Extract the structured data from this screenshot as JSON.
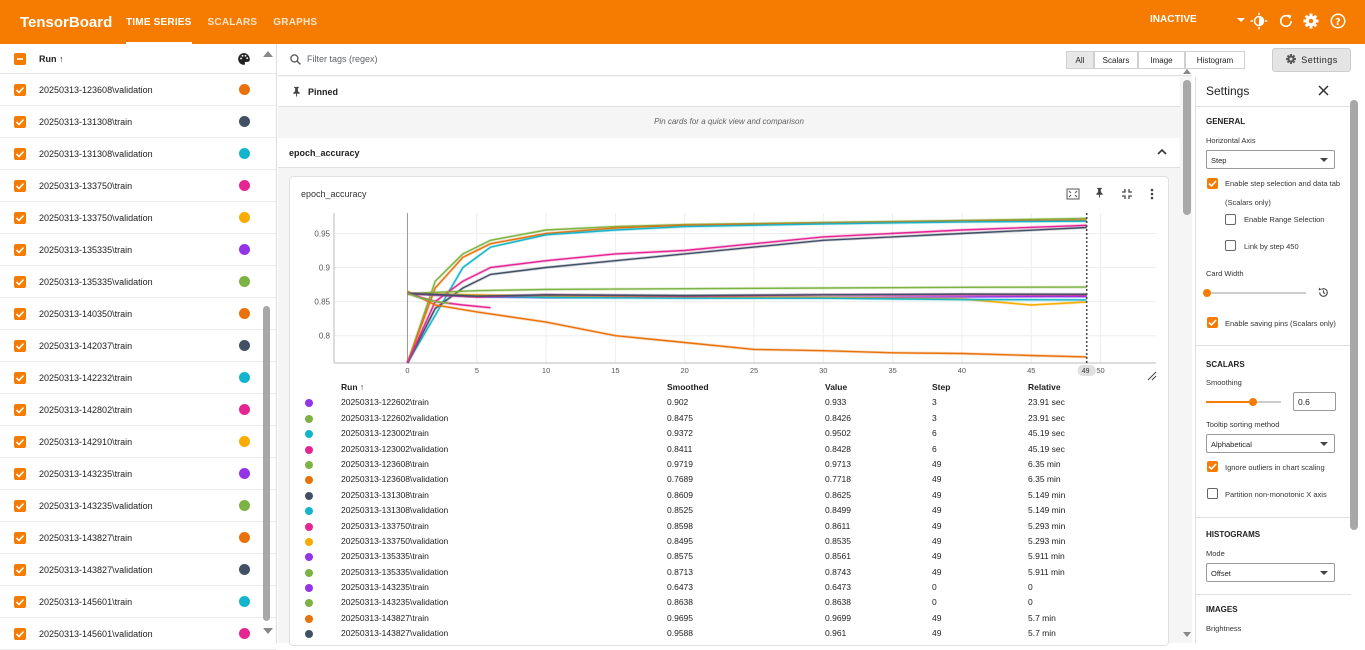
{
  "app": {
    "brand": "TensorBoard",
    "tabs": [
      "TIME SERIES",
      "SCALARS",
      "GRAPHS"
    ],
    "status": "INACTIVE"
  },
  "colors": {
    "accent": "#f57c00"
  },
  "runs_panel": {
    "header": "Run ↑",
    "rows": [
      {
        "name": "20250313-123608\\validation",
        "color": "#e8710a"
      },
      {
        "name": "20250313-131308\\train",
        "color": "#425066"
      },
      {
        "name": "20250313-131308\\validation",
        "color": "#12b5cb"
      },
      {
        "name": "20250313-133750\\train",
        "color": "#e52592"
      },
      {
        "name": "20250313-133750\\validation",
        "color": "#f9ab00"
      },
      {
        "name": "20250313-135335\\train",
        "color": "#9334e6"
      },
      {
        "name": "20250313-135335\\validation",
        "color": "#7cb342"
      },
      {
        "name": "20250313-140350\\train",
        "color": "#e8710a"
      },
      {
        "name": "20250313-142037\\train",
        "color": "#425066"
      },
      {
        "name": "20250313-142232\\train",
        "color": "#12b5cb"
      },
      {
        "name": "20250313-142802\\train",
        "color": "#e52592"
      },
      {
        "name": "20250313-142910\\train",
        "color": "#f9ab00"
      },
      {
        "name": "20250313-143235\\train",
        "color": "#9334e6"
      },
      {
        "name": "20250313-143235\\validation",
        "color": "#7cb342"
      },
      {
        "name": "20250313-143827\\train",
        "color": "#e8710a"
      },
      {
        "name": "20250313-143827\\validation",
        "color": "#425066"
      },
      {
        "name": "20250313-145601\\train",
        "color": "#12b5cb"
      },
      {
        "name": "20250313-145601\\validation",
        "color": "#e52592"
      }
    ]
  },
  "filter": {
    "placeholder": "Filter tags (regex)",
    "types": [
      "All",
      "Scalars",
      "Image",
      "Histogram"
    ],
    "settings_label": "Settings"
  },
  "pinned": {
    "title": "Pinned",
    "hint": "Pin cards for a quick view and comparison"
  },
  "group": {
    "title": "epoch_accuracy"
  },
  "card": {
    "title": "epoch_accuracy",
    "step_badge": "49",
    "table": {
      "headers": [
        "Run ↑",
        "Smoothed",
        "Value",
        "Step",
        "Relative"
      ],
      "rows": [
        {
          "run": "20250313-122602\\train",
          "smoothed": "0.902",
          "value": "0.933",
          "step": "3",
          "relative": "23.91 sec",
          "color": "#9334e6"
        },
        {
          "run": "20250313-122602\\validation",
          "smoothed": "0.8475",
          "value": "0.8426",
          "step": "3",
          "relative": "23.91 sec",
          "color": "#7cb342"
        },
        {
          "run": "20250313-123002\\train",
          "smoothed": "0.9372",
          "value": "0.9502",
          "step": "6",
          "relative": "45.19 sec",
          "color": "#12b5cb"
        },
        {
          "run": "20250313-123002\\validation",
          "smoothed": "0.8411",
          "value": "0.8428",
          "step": "6",
          "relative": "45.19 sec",
          "color": "#e52592"
        },
        {
          "run": "20250313-123608\\train",
          "smoothed": "0.9719",
          "value": "0.9713",
          "step": "49",
          "relative": "6.35 min",
          "color": "#7cb342"
        },
        {
          "run": "20250313-123608\\validation",
          "smoothed": "0.7689",
          "value": "0.7718",
          "step": "49",
          "relative": "6.35 min",
          "color": "#e8710a"
        },
        {
          "run": "20250313-131308\\train",
          "smoothed": "0.8609",
          "value": "0.8625",
          "step": "49",
          "relative": "5.149 min",
          "color": "#425066"
        },
        {
          "run": "20250313-131308\\validation",
          "smoothed": "0.8525",
          "value": "0.8499",
          "step": "49",
          "relative": "5.149 min",
          "color": "#12b5cb"
        },
        {
          "run": "20250313-133750\\train",
          "smoothed": "0.8598",
          "value": "0.8611",
          "step": "49",
          "relative": "5.293 min",
          "color": "#e52592"
        },
        {
          "run": "20250313-133750\\validation",
          "smoothed": "0.8495",
          "value": "0.8535",
          "step": "49",
          "relative": "5.293 min",
          "color": "#f9ab00"
        },
        {
          "run": "20250313-135335\\train",
          "smoothed": "0.8575",
          "value": "0.8561",
          "step": "49",
          "relative": "5.911 min",
          "color": "#9334e6"
        },
        {
          "run": "20250313-135335\\validation",
          "smoothed": "0.8713",
          "value": "0.8743",
          "step": "49",
          "relative": "5.911 min",
          "color": "#7cb342"
        },
        {
          "run": "20250313-143235\\train",
          "smoothed": "0.6473",
          "value": "0.6473",
          "step": "0",
          "relative": "0",
          "color": "#9334e6"
        },
        {
          "run": "20250313-143235\\validation",
          "smoothed": "0.8638",
          "value": "0.8638",
          "step": "0",
          "relative": "0",
          "color": "#7cb342"
        },
        {
          "run": "20250313-143827\\train",
          "smoothed": "0.9695",
          "value": "0.9699",
          "step": "49",
          "relative": "5.7 min",
          "color": "#e8710a"
        },
        {
          "run": "20250313-143827\\validation",
          "smoothed": "0.9588",
          "value": "0.961",
          "step": "49",
          "relative": "5.7 min",
          "color": "#425066"
        }
      ]
    }
  },
  "chart_data": {
    "type": "line",
    "title": "epoch_accuracy",
    "xlim": [
      0,
      50
    ],
    "ylim": [
      0.76,
      0.98
    ],
    "xticks": [
      0,
      5,
      10,
      15,
      20,
      25,
      30,
      35,
      40,
      45,
      50
    ],
    "yticks": [
      0.8,
      0.85,
      0.9,
      0.95
    ],
    "xtick_labels": [
      "0",
      "5",
      "10",
      "15",
      "20",
      "25",
      "30",
      "35",
      "40",
      "45",
      "50"
    ],
    "ytick_labels": [
      "0.8",
      "0.85",
      "0.9",
      "0.95"
    ],
    "series": [
      {
        "color": "#7cb342",
        "x": [
          0,
          2,
          4,
          6,
          10,
          15,
          20,
          30,
          40,
          49
        ],
        "y": [
          0.76,
          0.88,
          0.92,
          0.94,
          0.955,
          0.96,
          0.963,
          0.966,
          0.969,
          0.9719
        ]
      },
      {
        "color": "#e8710a",
        "x": [
          0,
          2,
          4,
          6,
          10,
          15,
          20,
          30,
          40,
          49
        ],
        "y": [
          0.76,
          0.87,
          0.915,
          0.935,
          0.95,
          0.958,
          0.962,
          0.965,
          0.968,
          0.9695
        ]
      },
      {
        "color": "#12b5cb",
        "x": [
          0,
          2,
          4,
          6,
          10,
          15,
          20,
          30,
          40,
          49
        ],
        "y": [
          0.76,
          0.83,
          0.9,
          0.93,
          0.948,
          0.955,
          0.96,
          0.964,
          0.967,
          0.968
        ]
      },
      {
        "color": "#425066",
        "x": [
          0,
          2,
          4,
          6,
          10,
          15,
          20,
          25,
          30,
          40,
          49
        ],
        "y": [
          0.76,
          0.84,
          0.87,
          0.89,
          0.9,
          0.91,
          0.92,
          0.93,
          0.94,
          0.95,
          0.9588
        ]
      },
      {
        "color": "#e52592",
        "x": [
          0,
          2,
          4,
          6,
          10,
          15,
          20,
          25,
          30,
          40,
          49
        ],
        "y": [
          0.76,
          0.85,
          0.88,
          0.9,
          0.91,
          0.92,
          0.925,
          0.935,
          0.945,
          0.955,
          0.962
        ]
      },
      {
        "color": "#e8710a",
        "x": [
          0,
          2,
          5,
          10,
          15,
          20,
          25,
          30,
          35,
          40,
          45,
          49
        ],
        "y": [
          0.865,
          0.845,
          0.835,
          0.82,
          0.8,
          0.79,
          0.78,
          0.778,
          0.775,
          0.774,
          0.771,
          0.7689
        ]
      },
      {
        "color": "#7cb342",
        "x": [
          0,
          5,
          10,
          20,
          30,
          40,
          49
        ],
        "y": [
          0.862,
          0.866,
          0.868,
          0.869,
          0.87,
          0.871,
          0.8713
        ]
      },
      {
        "color": "#9334e6",
        "x": [
          0,
          5,
          10,
          20,
          30,
          40,
          49
        ],
        "y": [
          0.862,
          0.857,
          0.856,
          0.857,
          0.856,
          0.857,
          0.8575
        ]
      },
      {
        "color": "#f9ab00",
        "x": [
          0,
          5,
          10,
          20,
          30,
          40,
          45,
          49
        ],
        "y": [
          0.862,
          0.86,
          0.858,
          0.857,
          0.856,
          0.854,
          0.845,
          0.8495
        ]
      },
      {
        "color": "#12b5cb",
        "x": [
          0,
          5,
          10,
          20,
          30,
          40,
          49
        ],
        "y": [
          0.862,
          0.858,
          0.856,
          0.855,
          0.855,
          0.853,
          0.8525
        ]
      },
      {
        "color": "#e52592",
        "x": [
          0,
          5,
          10,
          20,
          30,
          40,
          49
        ],
        "y": [
          0.862,
          0.857,
          0.86,
          0.858,
          0.86,
          0.86,
          0.8598
        ]
      },
      {
        "color": "#425066",
        "x": [
          0,
          5,
          10,
          20,
          30,
          40,
          49
        ],
        "y": [
          0.862,
          0.858,
          0.86,
          0.859,
          0.86,
          0.861,
          0.8609
        ]
      },
      {
        "color": "#e52592",
        "x": [
          0,
          2,
          4,
          6
        ],
        "y": [
          0.862,
          0.85,
          0.845,
          0.8411
        ]
      },
      {
        "color": "#7cb342",
        "x": [
          0,
          1,
          2,
          3
        ],
        "y": [
          0.862,
          0.855,
          0.85,
          0.8475
        ]
      }
    ]
  },
  "settings_panel": {
    "title": "Settings",
    "general": "GENERAL",
    "horizontal_axis_label": "Horizontal Axis",
    "horizontal_axis_value": "Step",
    "enable_step_selection": "Enable step selection and data tab",
    "scalars_only": "(Scalars only)",
    "enable_range": "Enable Range Selection",
    "link_by_step": "Link by step 450",
    "card_width": "Card Width",
    "enable_saving_pins": "Enable saving pins (Scalars only)",
    "scalars": "SCALARS",
    "smoothing": "Smoothing",
    "smoothing_value": "0.6",
    "tooltip_sorting": "Tooltip sorting method",
    "tooltip_sorting_value": "Alphabetical",
    "ignore_outliers": "Ignore outliers in chart scaling",
    "partition": "Partition non-monotonic X axis",
    "histograms": "HISTOGRAMS",
    "mode": "Mode",
    "mode_value": "Offset",
    "images": "IMAGES",
    "brightness": "Brightness"
  }
}
